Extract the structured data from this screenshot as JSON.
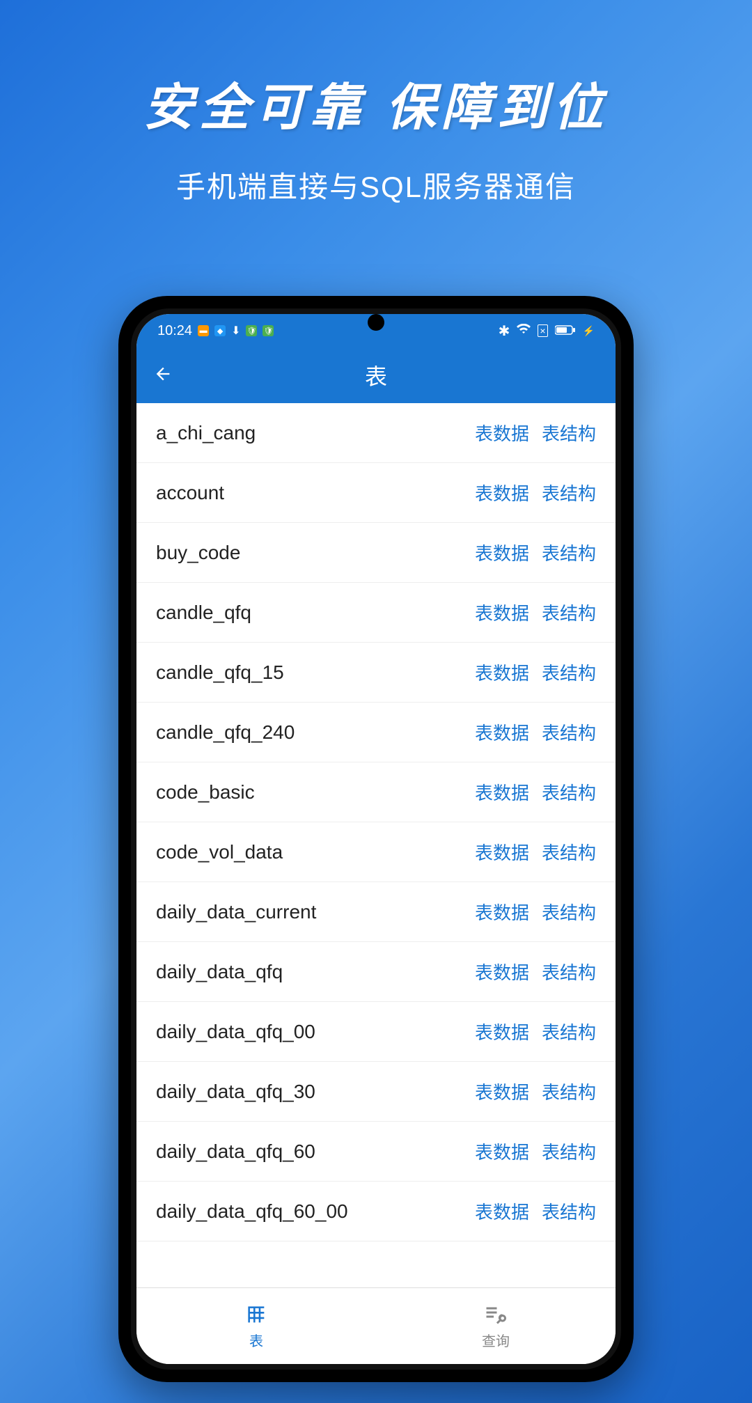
{
  "promo": {
    "title": "安全可靠 保障到位",
    "subtitle": "手机端直接与SQL服务器通信"
  },
  "status_bar": {
    "time": "10:24"
  },
  "nav": {
    "title": "表"
  },
  "action_labels": {
    "data": "表数据",
    "structure": "表结构"
  },
  "tables": [
    {
      "name": "a_chi_cang"
    },
    {
      "name": "account"
    },
    {
      "name": "buy_code"
    },
    {
      "name": "candle_qfq"
    },
    {
      "name": "candle_qfq_15"
    },
    {
      "name": "candle_qfq_240"
    },
    {
      "name": "code_basic"
    },
    {
      "name": "code_vol_data"
    },
    {
      "name": "daily_data_current"
    },
    {
      "name": "daily_data_qfq"
    },
    {
      "name": "daily_data_qfq_00"
    },
    {
      "name": "daily_data_qfq_30"
    },
    {
      "name": "daily_data_qfq_60"
    },
    {
      "name": "daily_data_qfq_60_00"
    }
  ],
  "bottom_nav": {
    "tables": "表",
    "query": "查询"
  }
}
